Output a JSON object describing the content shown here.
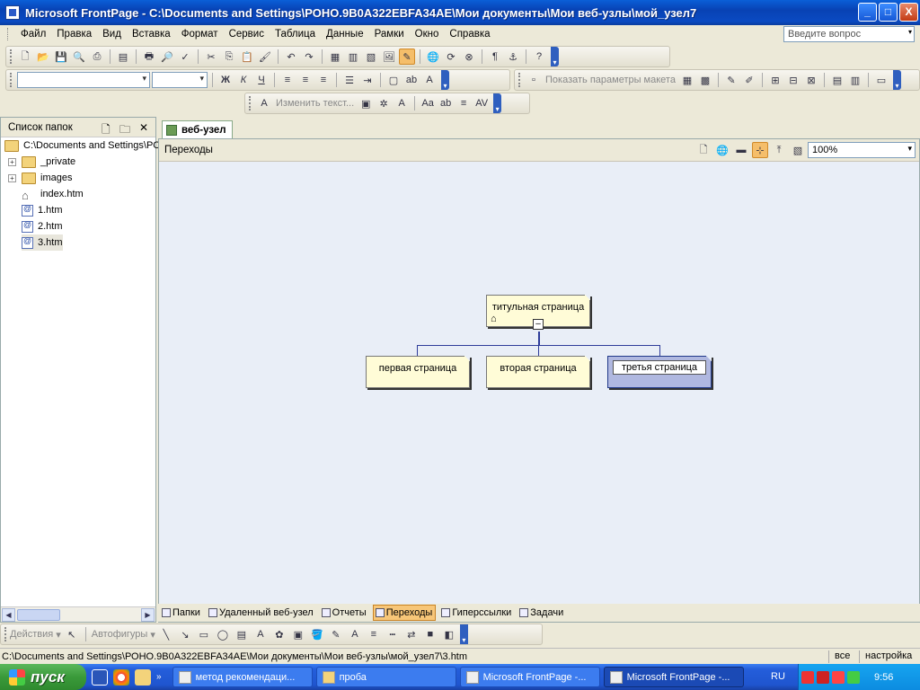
{
  "window": {
    "title": "Microsoft FrontPage - C:\\Documents and Settings\\РОНО.9В0А322EBFA34AE\\Мои документы\\Мои веб-узлы\\мой_узел7",
    "min": "_",
    "max": "□",
    "close": "X"
  },
  "menu": [
    "Файл",
    "Правка",
    "Вид",
    "Вставка",
    "Формат",
    "Сервис",
    "Таблица",
    "Данные",
    "Рамки",
    "Окно",
    "Справка"
  ],
  "ask_placeholder": "Введите вопрос",
  "toolbars": {
    "layout_label": "Показать параметры макета",
    "picture_label": "Изменить текст..."
  },
  "folder_pane": {
    "title": "Список папок",
    "root": "C:\\Documents and Settings\\PC",
    "items": [
      {
        "label": "_private",
        "type": "folder"
      },
      {
        "label": "images",
        "type": "folder"
      },
      {
        "label": "index.htm",
        "type": "home"
      },
      {
        "label": "1.htm",
        "type": "page"
      },
      {
        "label": "2.htm",
        "type": "page"
      },
      {
        "label": "3.htm",
        "type": "page"
      }
    ]
  },
  "doc_tab": "веб-узел",
  "view": {
    "name": "Переходы",
    "zoom": "100%"
  },
  "navigation": {
    "root": "титульная страница",
    "children": [
      "первая страница",
      "вторая страница",
      "третья страница"
    ],
    "selected": "третья страница"
  },
  "view_tabs": [
    "Папки",
    "Удаленный веб-узел",
    "Отчеты",
    "Переходы",
    "Гиперссылки",
    "Задачи"
  ],
  "active_view_tab": "Переходы",
  "drawing": {
    "actions": "Действия",
    "autoshapes": "Автофигуры"
  },
  "status": {
    "path": "C:\\Documents and Settings\\РОНО.9В0А322EBFA34AE\\Мои документы\\Мои веб-узлы\\мой_узел7\\3.htm",
    "all": "все",
    "settings": "настройка"
  },
  "taskbar": {
    "start": "пуск",
    "tasks": [
      "метод рекомендаци...",
      "проба",
      "Microsoft FrontPage -...",
      "Microsoft FrontPage -..."
    ],
    "active_task": 3,
    "lang": "RU",
    "clock": "9:56"
  },
  "colors": {
    "title_bar": "#0a4ac2",
    "canvas": "#e9eef7",
    "node_fill": "#fffcd7",
    "selected_node": "#b0b8e0",
    "active_tab": "#f7c678"
  }
}
